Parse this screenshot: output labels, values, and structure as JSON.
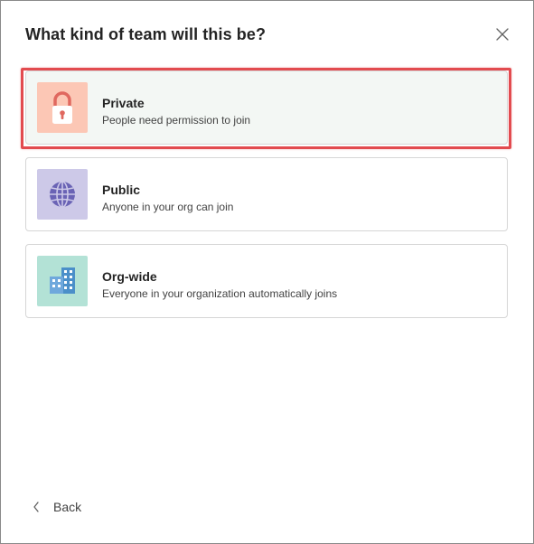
{
  "dialog": {
    "title": "What kind of team will this be?",
    "close_icon": "close-icon",
    "options": [
      {
        "key": "private",
        "title": "Private",
        "description": "People need permission to join",
        "icon": "lock-icon",
        "tile_color": "#fcc7b5",
        "icon_color": "#e0685f",
        "selected": true
      },
      {
        "key": "public",
        "title": "Public",
        "description": "Anyone in your org can join",
        "icon": "globe-icon",
        "tile_color": "#cdc9e8",
        "icon_color": "#6a63b5",
        "selected": false
      },
      {
        "key": "org-wide",
        "title": "Org-wide",
        "description": "Everyone in your organization automatically joins",
        "icon": "building-icon",
        "tile_color": "#b3e2d6",
        "icon_color": "#4b8fc9",
        "selected": false
      }
    ],
    "highlight_color": "#e24b4f",
    "back_label": "Back",
    "back_icon": "chevron-left-icon"
  }
}
